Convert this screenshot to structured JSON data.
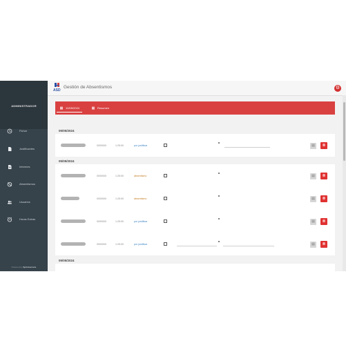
{
  "sidebar": {
    "title": "ADMINISTRADOR",
    "items": [
      {
        "label": "Fichar",
        "icon": "clock-icon"
      },
      {
        "label": "Justificantes",
        "icon": "document-icon"
      },
      {
        "label": "Informes",
        "icon": "report-icon"
      },
      {
        "label": "Absentismos",
        "icon": "calendar-off-icon"
      },
      {
        "label": "Usuarios",
        "icon": "users-icon"
      },
      {
        "label": "Horas Extras",
        "icon": "alarm-icon"
      }
    ],
    "footer_prefix": "Powered by",
    "footer_brand": "Sprintserveis"
  },
  "header": {
    "title": "Gestión de Absentismos",
    "logo_text": "ASD",
    "settings_icon": "gear-icon"
  },
  "tabs": [
    {
      "label": "10/05/2024",
      "icon": "calendar-edit-icon"
    },
    {
      "label": "Resumen",
      "icon": "calendar-grid-icon"
    }
  ],
  "groups": [
    {
      "date": "05/05/2024",
      "rows": [
        {
          "phone": "0000000",
          "time": "1:25:00",
          "status": "por justificar",
          "action_icon": "save-icon",
          "delete_icon": "delete-icon"
        }
      ]
    },
    {
      "date": "05/05/2024",
      "rows": [
        {
          "phone": "0000000",
          "time": "1:25:00",
          "status": "absentismo",
          "action_icon": "save-icon",
          "delete_icon": "delete-icon"
        },
        {
          "phone": "0000000",
          "time": "1:25:00",
          "status": "absentismo",
          "action_icon": "save-icon",
          "delete_icon": "delete-icon"
        },
        {
          "phone": "0000000",
          "time": "1:25:00",
          "status": "por justificar",
          "action_icon": "save-icon",
          "delete_icon": "delete-icon"
        },
        {
          "phone": "0000000",
          "time": "1:25:00",
          "status": "por justificar",
          "action_icon": "save-icon",
          "delete_icon": "delete-icon"
        }
      ]
    },
    {
      "date": "05/05/2024",
      "rows": []
    }
  ],
  "colors": {
    "accent": "#d94141",
    "sidebar": "#37434b",
    "link": "#3c84c7"
  }
}
